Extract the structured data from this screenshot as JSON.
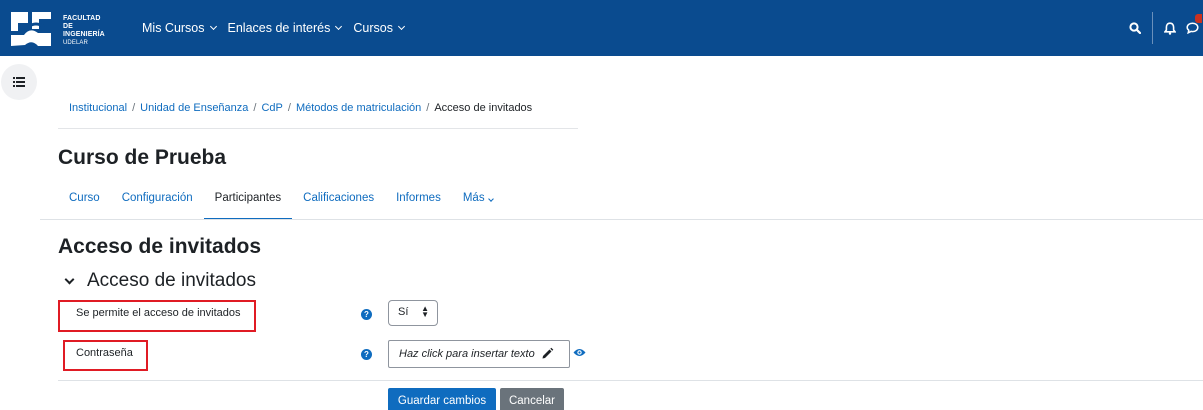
{
  "navbar": {
    "logo_lines": [
      "FACULTAD DE",
      "INGENIERÍA",
      "UDELAR"
    ],
    "menu": [
      {
        "label": "Mis Cursos"
      },
      {
        "label": "Enlaces de interés"
      },
      {
        "label": "Cursos"
      }
    ],
    "background": "#0a4b8f"
  },
  "breadcrumb": [
    "Institucional",
    "Unidad de Enseñanza",
    "CdP",
    "Métodos de matriculación",
    "Acceso de invitados"
  ],
  "course_title": "Curso de Prueba",
  "tabs": [
    {
      "label": "Curso"
    },
    {
      "label": "Configuración"
    },
    {
      "label": "Participantes",
      "active": true
    },
    {
      "label": "Calificaciones"
    },
    {
      "label": "Informes"
    },
    {
      "label": "Más"
    }
  ],
  "page_heading": "Acceso de invitados",
  "section": {
    "title": "Acceso de invitados"
  },
  "fields": {
    "guest_access": {
      "label": "Se permite el acceso de invitados",
      "value": "Sí"
    },
    "password": {
      "label": "Contraseña",
      "placeholder": "Haz click para insertar texto"
    }
  },
  "buttons": {
    "save": "Guardar cambios",
    "cancel": "Cancelar"
  },
  "icons": {
    "search": "search-icon",
    "bell": "bell-icon",
    "chat": "chat-icon",
    "drawer": "list-icon",
    "help": "question-circle-icon",
    "edit": "pencil-icon",
    "reveal": "eye-icon"
  },
  "colors": {
    "accent": "#0f6cbf",
    "highlight": "#e01b24"
  }
}
